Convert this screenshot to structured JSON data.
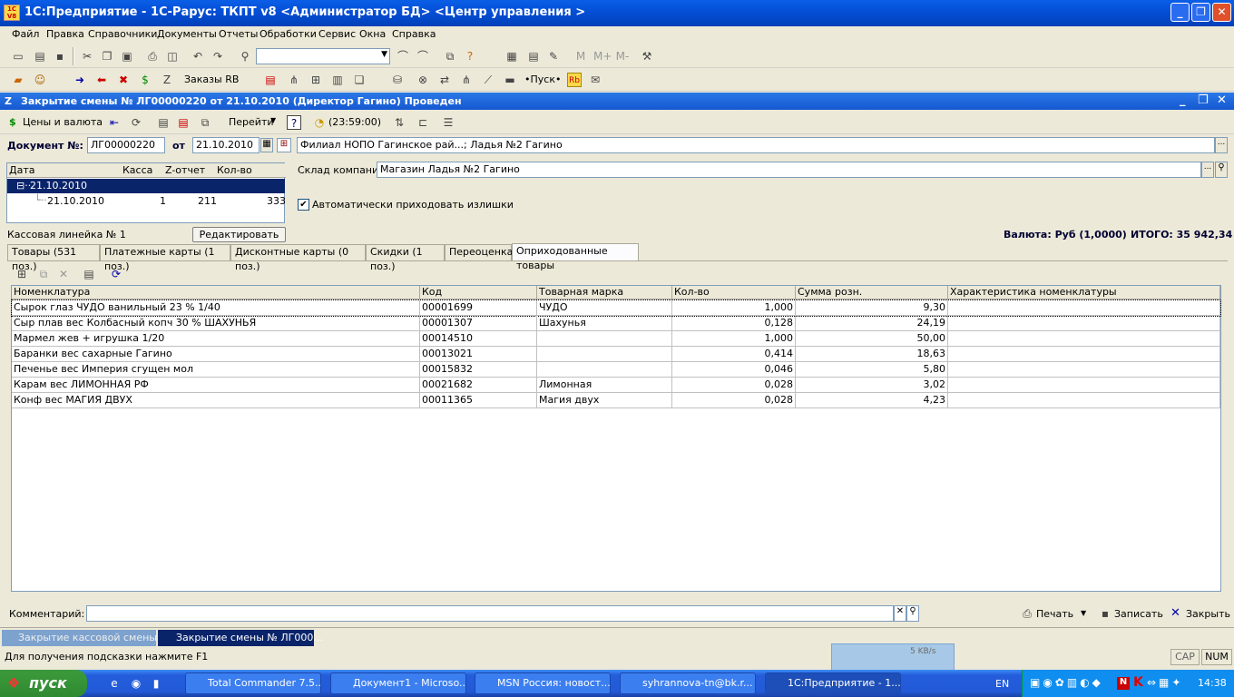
{
  "window": {
    "title": "1С:Предприятие - 1С-Рарус: ТКПТ v8 <Администратор БД> <Центр управления >",
    "minimize": "_",
    "maximize": "❐",
    "close": "✕"
  },
  "menu": [
    "Файл",
    "Правка",
    "Справочники",
    "Документы",
    "Отчеты",
    "Обработки",
    "Сервис",
    "Окна",
    "Справка"
  ],
  "toolbar2": {
    "orders": "Заказы RB",
    "start": "•Пуск•"
  },
  "doc": {
    "title": "Закрытие смены № ЛГ00000220 от 21.10.2010 (Директор Гагино) Проведен",
    "btn_prices": "Цены и валюта",
    "btn_goto": "Перейти",
    "time": "(23:59:00)",
    "doc_no_label": "Документ №:",
    "doc_no": "ЛГ00000220",
    "from_label": "от",
    "date": "21.10.2010",
    "branch": "Филиал НОПО Гагинское рай...; Ладья №2 Гагино",
    "warehouse_label": "Склад компании:",
    "warehouse": "Магазин Ладья №2 Гагино",
    "auto_label": "Автоматически приходовать излишки",
    "register": "Кассовая линейка № 1",
    "edit_btn": "Редактировать",
    "currency": "Валюта: Руб (1,0000)",
    "total": "ИТОГО: 35 942,34",
    "comment_label": "Комментарий:",
    "print": "Печать",
    "save": "Записать",
    "close": "Закрыть"
  },
  "shifts": {
    "headers": [
      "Дата",
      "Касса",
      "Z-отчет",
      "Кол-во чеков"
    ],
    "group": "21.10.2010",
    "row": [
      "21.10.2010",
      "1",
      "211",
      "333"
    ]
  },
  "tabs": [
    "Товары (531 поз.)",
    "Платежные карты (1 поз.)",
    "Дисконтные карты (0 поз.)",
    "Скидки (1 поз.)",
    "Переоценка",
    "Оприходованные товары"
  ],
  "table": {
    "headers": [
      "Номенклатура",
      "Код",
      "Товарная марка",
      "Кол-во",
      "Сумма розн.",
      "Характеристика номенклатуры"
    ],
    "rows": [
      [
        "Сырок глаз ЧУДО ванильный 23 % 1/40",
        "00001699",
        "ЧУДО",
        "1,000",
        "9,30",
        ""
      ],
      [
        "Сыр плав вес Колбасный копч 30 % ШАХУНЬЯ",
        "00001307",
        "Шахунья",
        "0,128",
        "24,19",
        ""
      ],
      [
        "Мармел жев + игрушка 1/20",
        "00014510",
        "",
        "1,000",
        "50,00",
        ""
      ],
      [
        "Баранки вес сахарные Гагино",
        "00013021",
        "",
        "0,414",
        "18,63",
        ""
      ],
      [
        "Печенье вес Империя сгущен мол",
        "00015832",
        "",
        "0,046",
        "5,80",
        ""
      ],
      [
        "Карам вес ЛИМОННАЯ РФ",
        "00021682",
        "Лимонная",
        "0,028",
        "3,02",
        ""
      ],
      [
        "Конф вес МАГИЯ ДВУХ",
        "00011365",
        "Магия двух",
        "0,028",
        "4,23",
        ""
      ]
    ]
  },
  "windows_bar": [
    "Закрытие кассовой смены",
    "Закрытие смены № ЛГ000..."
  ],
  "status": {
    "hint": "Для получения подсказки нажмите F1",
    "cap": "CAP",
    "num": "NUM",
    "speed": "5 KB/s"
  },
  "taskbar": {
    "start": "пуск",
    "items": [
      "Total Commander 7.5...",
      "Документ1 - Microso...",
      "MSN Россия: новост...",
      "syhrannova-tn@bk.r...",
      "1С:Предприятие - 1..."
    ],
    "lang": "EN",
    "clock": "14:38"
  }
}
